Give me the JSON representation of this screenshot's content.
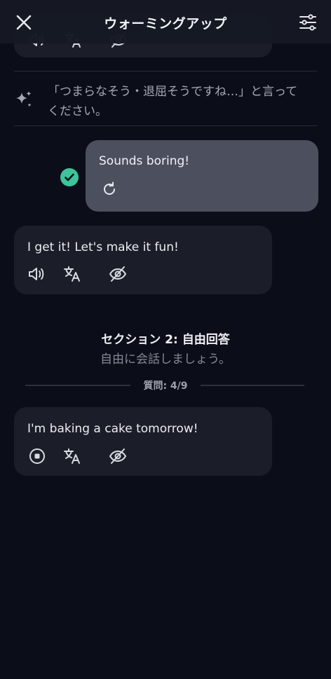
{
  "header": {
    "title": "ウォーミングアップ",
    "close_icon": "close-icon",
    "settings_icon": "sliders-icon"
  },
  "instruction": {
    "text": "「つまらなそう・退屈そうですね…」と言ってください。",
    "icon": "sparkle-icon"
  },
  "user_message": {
    "text": "Sounds boring!",
    "status_icon": "check-circle-icon",
    "retry_icon": "retry-icon"
  },
  "ai_messages": [
    {
      "text": "I get it! Let's make it fun!",
      "icons": [
        "speaker-icon",
        "translate-icon",
        "hide-icon"
      ]
    },
    {
      "text": "I'm baking a cake tomorrow!",
      "icons": [
        "stop-icon",
        "translate-icon",
        "hide-icon"
      ]
    }
  ],
  "section": {
    "title": "セクション 2: 自由回答",
    "subtitle": "自由に会話しましょう。",
    "progress_label": "質問: 4/9"
  },
  "colors": {
    "background": "#0b0e19",
    "ai_bubble": "#1b1d28",
    "user_bubble": "#4c4f5e",
    "accent_check": "#3ec49a"
  }
}
